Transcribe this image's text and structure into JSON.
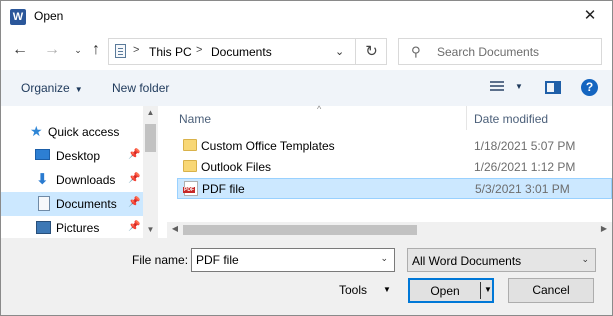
{
  "window": {
    "title": "Open",
    "app_icon_letter": "W"
  },
  "nav": {
    "back_icon": "arrow-left-icon",
    "forward_icon": "arrow-right-icon",
    "up_icon": "arrow-up-icon"
  },
  "address": {
    "crumbs": [
      "This PC",
      "Documents"
    ],
    "separator": ">"
  },
  "search": {
    "placeholder": "Search Documents"
  },
  "toolbar": {
    "organize_label": "Organize",
    "new_folder_label": "New folder",
    "help_label": "?"
  },
  "sidebar": {
    "items": [
      {
        "label": "Quick access",
        "icon": "star-icon",
        "pinned": false
      },
      {
        "label": "Desktop",
        "icon": "desktop-icon",
        "pinned": true
      },
      {
        "label": "Downloads",
        "icon": "download-icon",
        "pinned": true
      },
      {
        "label": "Documents",
        "icon": "documents-icon",
        "pinned": true,
        "selected": true
      },
      {
        "label": "Pictures",
        "icon": "pictures-icon",
        "pinned": true
      }
    ]
  },
  "filelist": {
    "columns": {
      "name": "Name",
      "date": "Date modified"
    },
    "rows": [
      {
        "name": "Custom Office Templates",
        "date": "1/18/2021 5:07 PM",
        "type": "folder"
      },
      {
        "name": "Outlook Files",
        "date": "1/26/2021 1:12 PM",
        "type": "folder"
      },
      {
        "name": "PDF file",
        "date": "5/3/2021 3:01 PM",
        "type": "pdf",
        "selected": true
      }
    ]
  },
  "footer": {
    "filename_label": "File name:",
    "filename_value": "PDF file",
    "filter_value": "All Word Documents",
    "tools_label": "Tools",
    "open_label": "Open",
    "cancel_label": "Cancel"
  },
  "colors": {
    "accent": "#0078d7",
    "selection": "#cce8ff",
    "command_bar": "#f0f4f9"
  }
}
